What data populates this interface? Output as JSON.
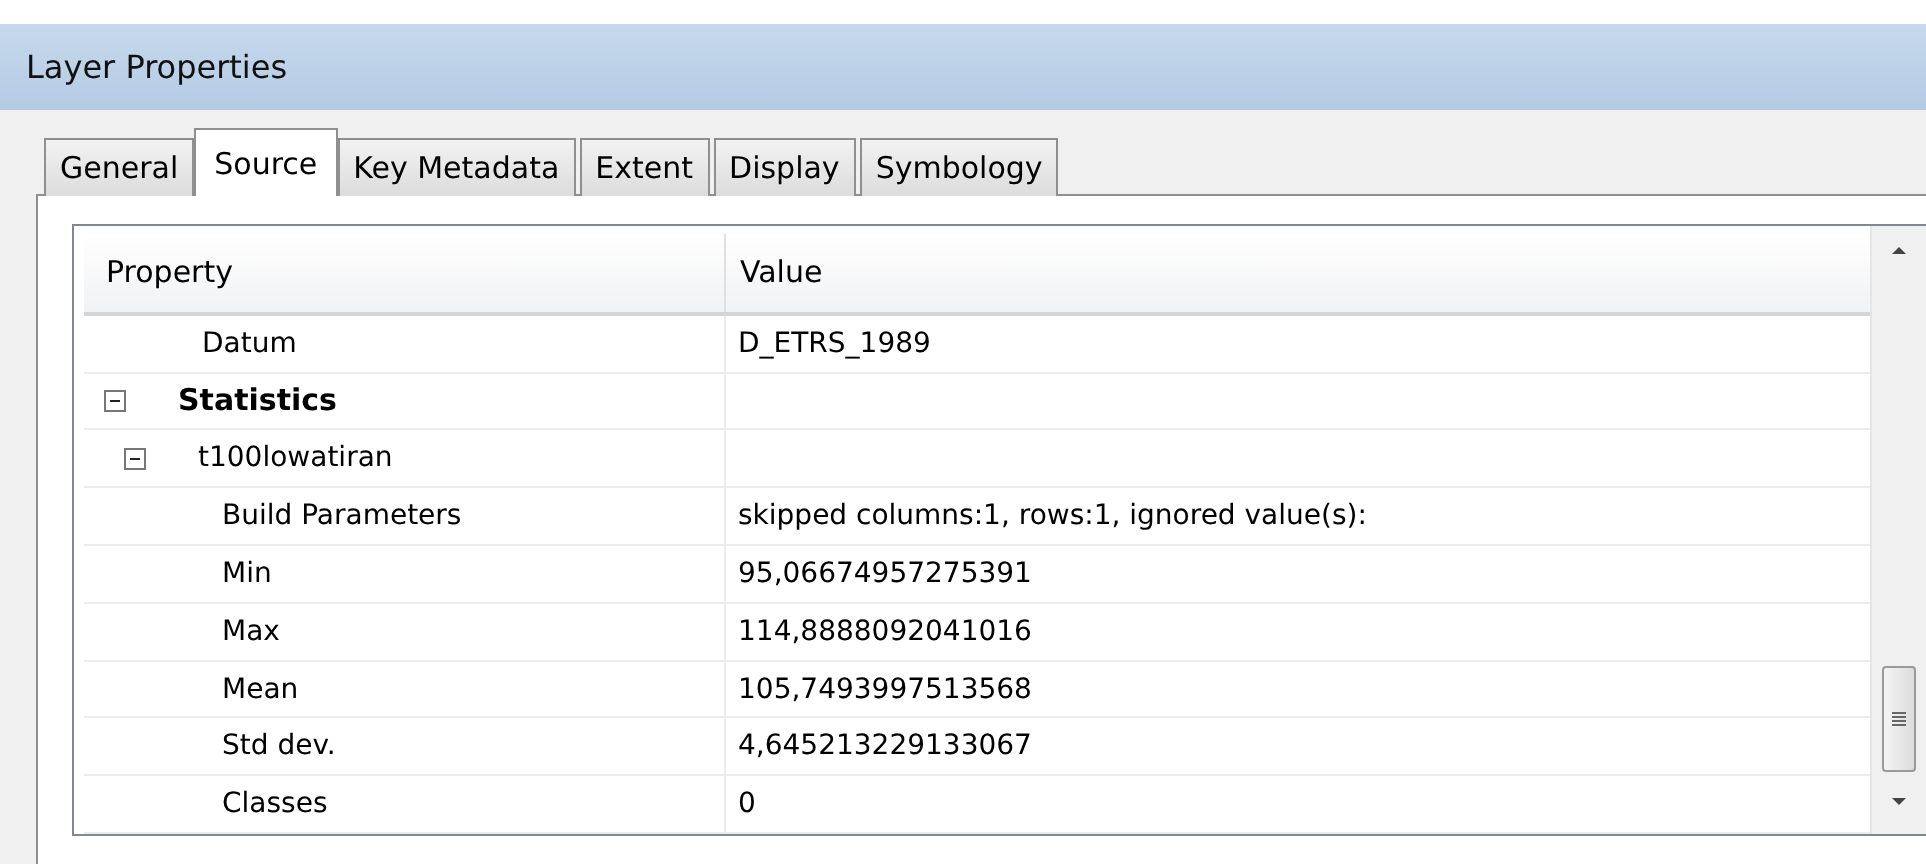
{
  "window": {
    "title": "Layer Properties"
  },
  "tabs": [
    {
      "label": "General",
      "selected": false
    },
    {
      "label": "Source",
      "selected": true
    },
    {
      "label": "Key Metadata",
      "selected": false
    },
    {
      "label": "Extent",
      "selected": false
    },
    {
      "label": "Display",
      "selected": false
    },
    {
      "label": "Symbology",
      "selected": false
    }
  ],
  "table": {
    "columns": [
      "Property",
      "Value"
    ],
    "rows": [
      {
        "property": "Datum",
        "value": "D_ETRS_1989"
      },
      {
        "property": "Statistics",
        "expanded": true,
        "children": [
          {
            "property": "t100lowatiran",
            "expanded": true,
            "children": [
              {
                "property": "Build Parameters",
                "value": "skipped columns:1, rows:1, ignored value(s):"
              },
              {
                "property": "Min",
                "value": "95,06674957275391"
              },
              {
                "property": "Max",
                "value": "114,8888092041016"
              },
              {
                "property": "Mean",
                "value": "105,7493997513568"
              },
              {
                "property": "Std dev.",
                "value": "4,645213229133067"
              },
              {
                "property": "Classes",
                "value": "0"
              }
            ]
          }
        ]
      }
    ]
  }
}
